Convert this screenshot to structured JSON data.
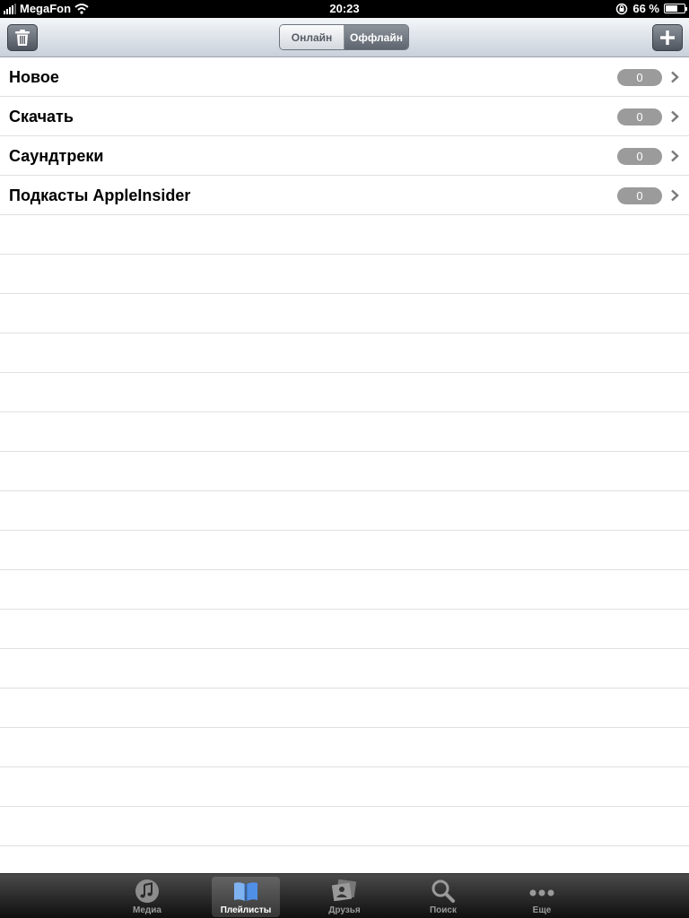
{
  "status_bar": {
    "carrier": "MegaFon",
    "time": "20:23",
    "battery": "66 %",
    "battery_level": 0.66
  },
  "toolbar": {
    "left_icon": "trash-icon",
    "right_icon": "plus-icon",
    "segments": [
      {
        "label": "Онлайн",
        "selected": false
      },
      {
        "label": "Оффлайн",
        "selected": true
      }
    ]
  },
  "playlists": [
    {
      "name": "Новое",
      "count": "0"
    },
    {
      "name": "Скачать",
      "count": "0"
    },
    {
      "name": "Саундтреки",
      "count": "0"
    },
    {
      "name": "Подкасты AppleInsider",
      "count": "0"
    }
  ],
  "tab_bar": {
    "tabs": [
      {
        "label": "Медиа",
        "icon": "music-note-icon",
        "active": false
      },
      {
        "label": "Плейлисты",
        "icon": "book-icon",
        "active": true
      },
      {
        "label": "Друзья",
        "icon": "friends-photo-icon",
        "active": false
      },
      {
        "label": "Поиск",
        "icon": "search-icon",
        "active": false
      },
      {
        "label": "Еще",
        "icon": "more-dots-icon",
        "active": false
      }
    ]
  },
  "colors": {
    "badge": "#9b9b9b",
    "toolbar_button": "#5f656e",
    "tab_bar": "#1a1a1a"
  }
}
